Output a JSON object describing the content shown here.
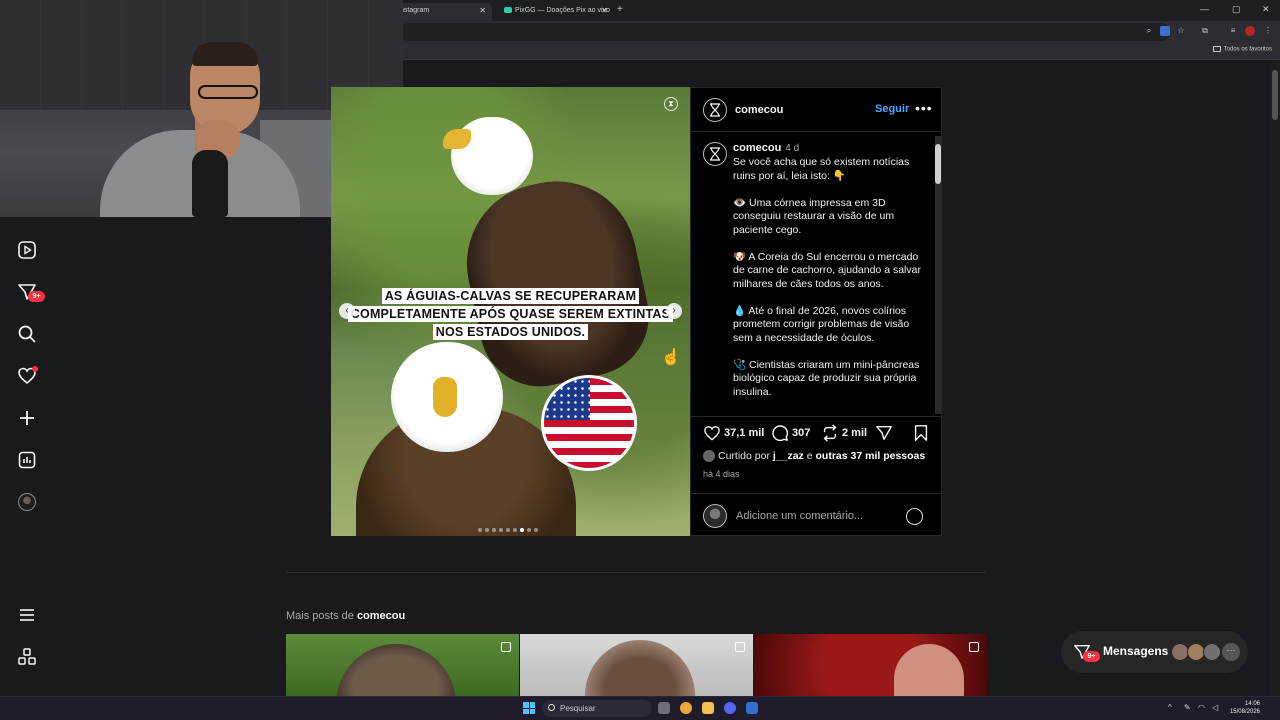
{
  "browser": {
    "tabs": [
      {
        "label": "nstagram",
        "active": true
      },
      {
        "label": "PixGG — Doações Pix ao vivo",
        "active": false
      }
    ],
    "bookmarks_folder": "Todos os favoritos"
  },
  "nav": {
    "items": [
      "reels-icon",
      "messages-icon",
      "search-icon",
      "notifications-icon",
      "create-icon",
      "dashboard-icon",
      "profile-avatar",
      "menu-icon",
      "more-apps-icon"
    ],
    "messages_badge": "9+"
  },
  "post": {
    "image_caption_lines": [
      "AS ÁGUIAS-CALVAS SE RECUPERARAM",
      "COMPLETAMENTE APÓS QUASE SEREM EXTINTAS",
      "NOS ESTADOS UNIDOS."
    ],
    "carousel": {
      "count": 9,
      "active": 6
    },
    "header": {
      "username": "comecou",
      "follow_label": "Seguir",
      "more_label": "•••"
    },
    "caption": {
      "username": "comecou",
      "time": "4 d",
      "paragraphs": [
        "Se você acha que só existem notícias ruins por aí, leia isto: 👇",
        "👁️ Uma córnea impressa em 3D conseguiu restaurar a visão de um paciente cego.",
        "🐶 A Coreia do Sul encerrou o mercado de carne de cachorro, ajudando a salvar milhares de cães todos os anos.",
        "💧 Até o final de 2026, novos colírios prometem corrigir problemas de visão sem a necessidade de óculos.",
        "🩺 Cientistas criaram um mini-pâncreas biológico capaz de produzir sua própria insulina."
      ]
    },
    "stats": {
      "likes": "37,1 mil",
      "comments": "307",
      "reposts": "2 mil"
    },
    "liked_by": {
      "prefix": "Curtido por",
      "user": "j__zaz",
      "connector": "e",
      "others": "outras 37 mil pessoas"
    },
    "posted": "há 4 dias",
    "comment_placeholder": "Adicione um comentário..."
  },
  "more_posts": {
    "prefix": "Mais posts de",
    "user": "comecou"
  },
  "messages": {
    "label": "Mensagens",
    "badge": "9+"
  },
  "taskbar": {
    "search_label": "Pesquisar",
    "time": "14:06",
    "date": "15/08/2026"
  },
  "colors": {
    "accent_blue": "#4aa3ff",
    "badge_red": "#ff3040",
    "panel_bg": "#000000",
    "page_bg": "#181a1d"
  }
}
